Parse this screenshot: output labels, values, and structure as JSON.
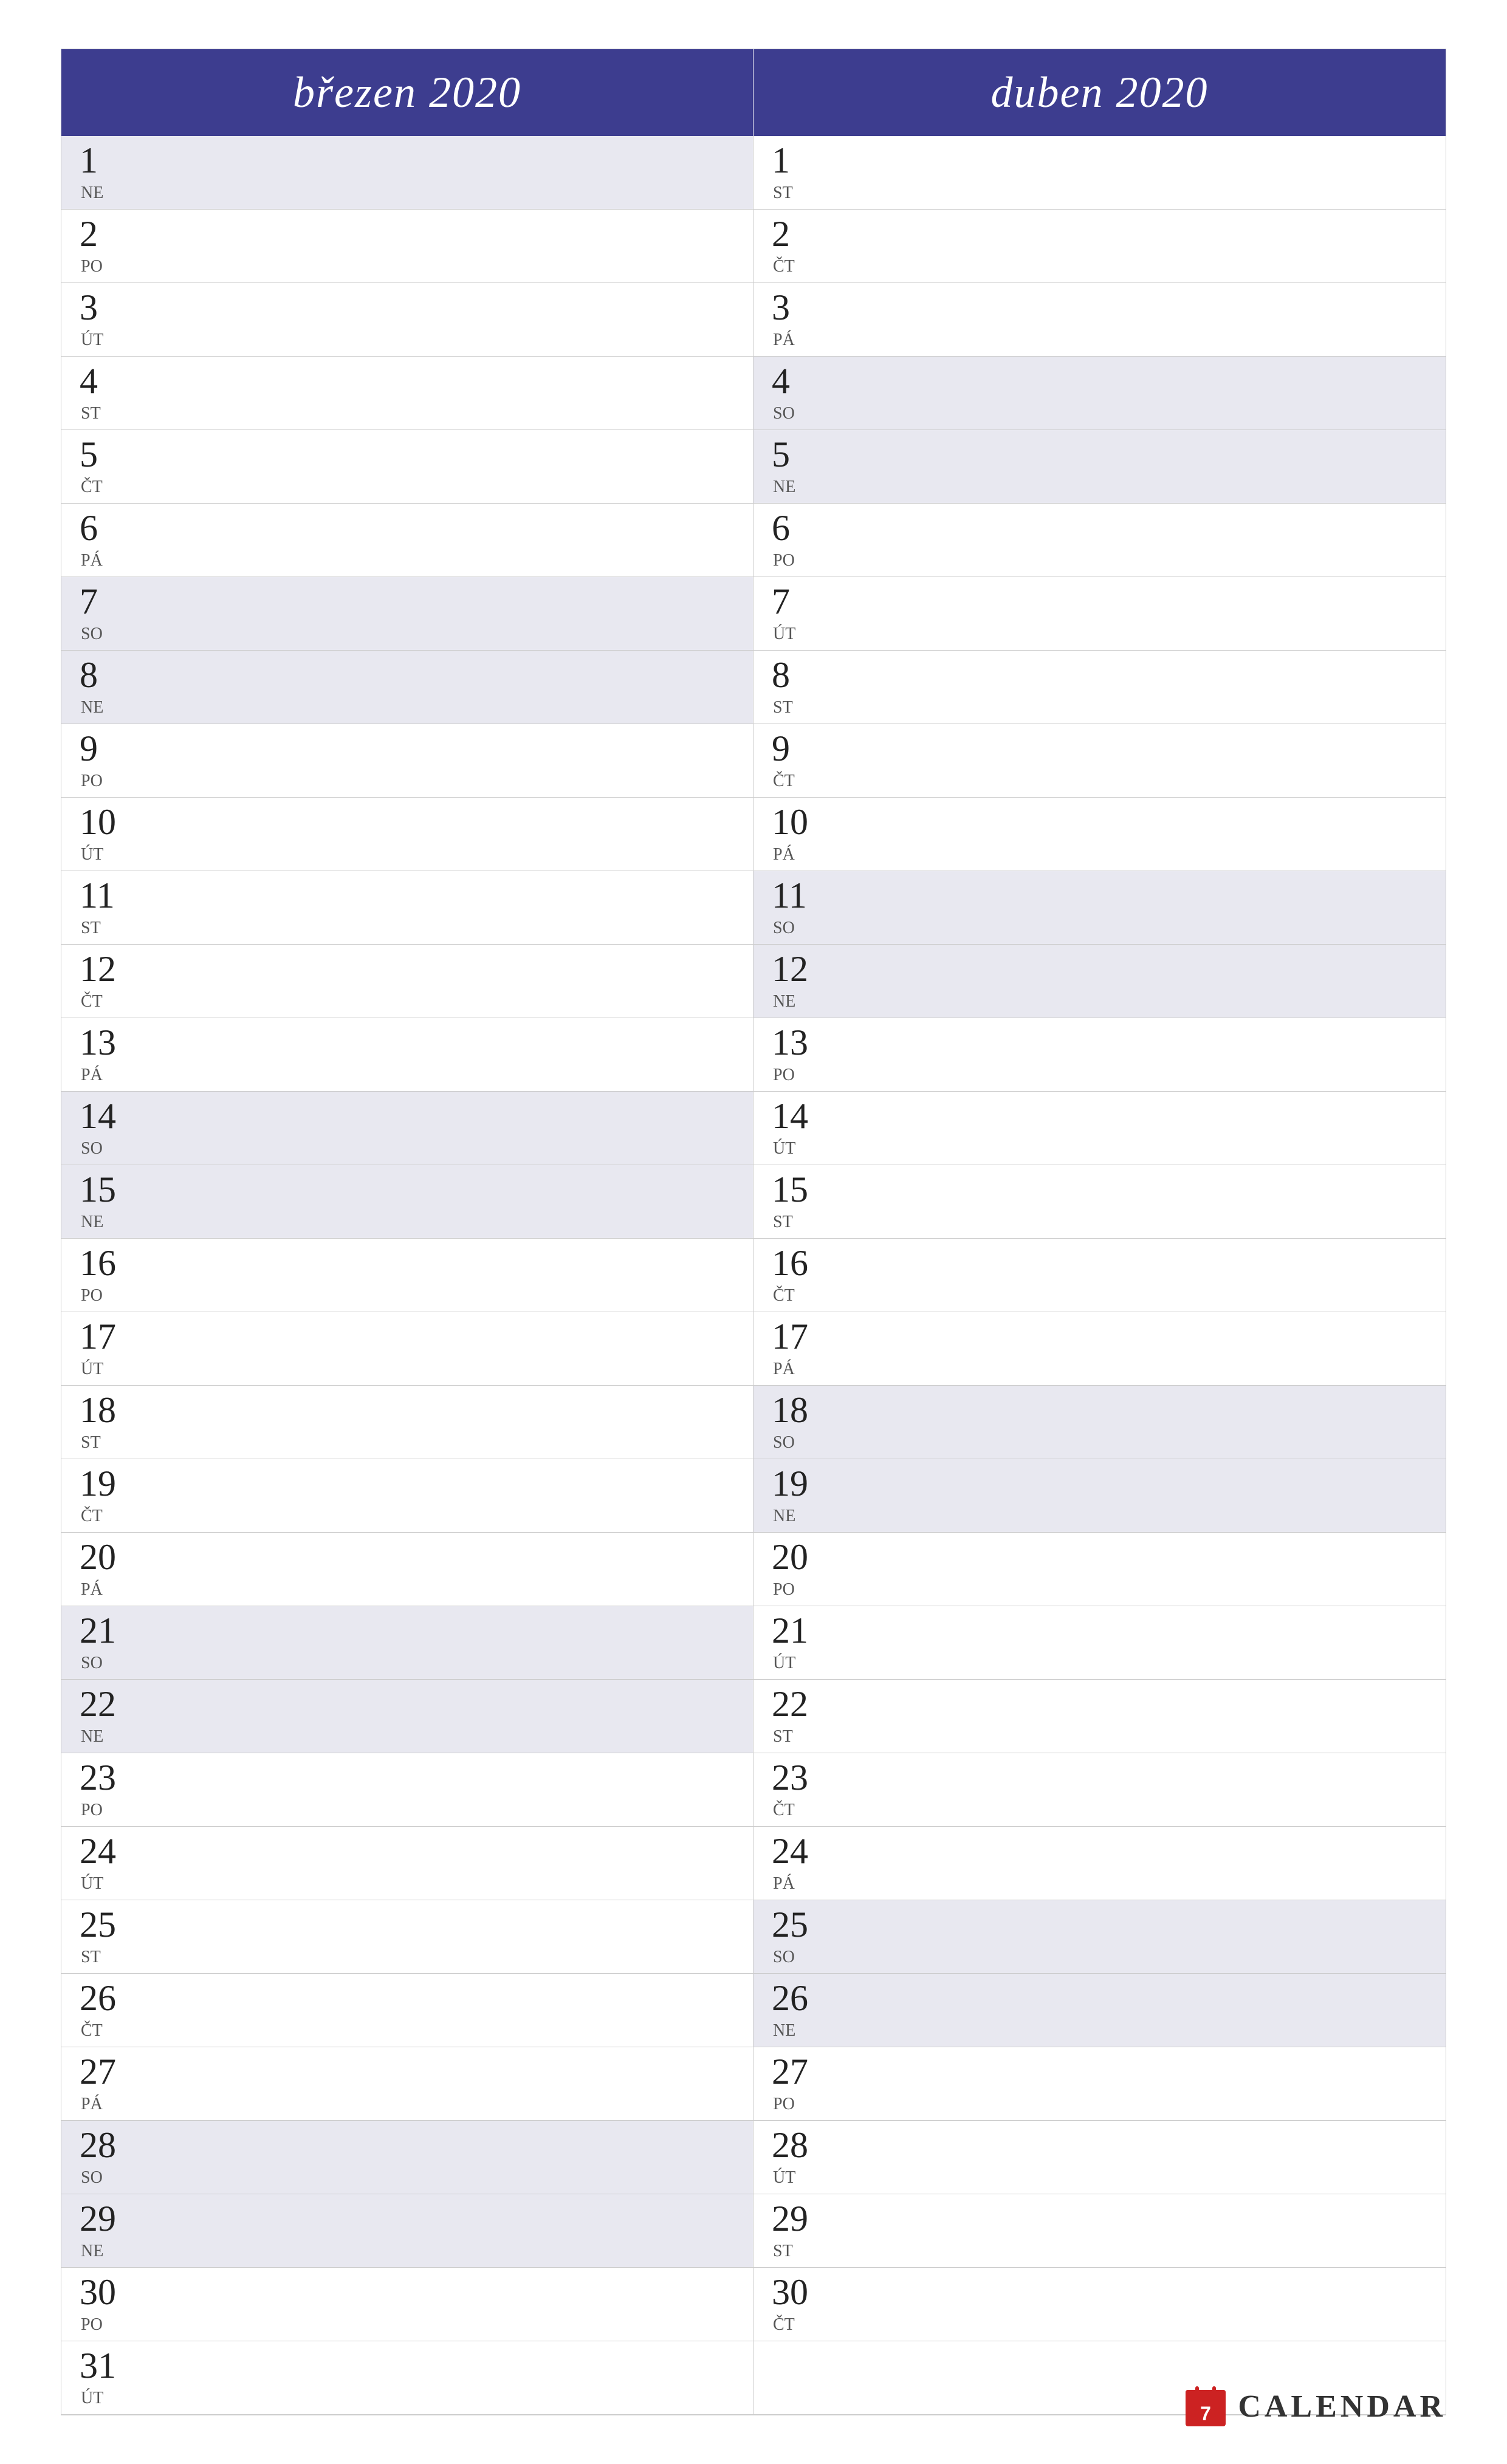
{
  "months": [
    {
      "name": "březen 2020",
      "days": [
        {
          "num": "1",
          "abbr": "NE",
          "weekend": true
        },
        {
          "num": "2",
          "abbr": "PO",
          "weekend": false
        },
        {
          "num": "3",
          "abbr": "ÚT",
          "weekend": false
        },
        {
          "num": "4",
          "abbr": "ST",
          "weekend": false
        },
        {
          "num": "5",
          "abbr": "ČT",
          "weekend": false
        },
        {
          "num": "6",
          "abbr": "PÁ",
          "weekend": false
        },
        {
          "num": "7",
          "abbr": "SO",
          "weekend": true
        },
        {
          "num": "8",
          "abbr": "NE",
          "weekend": true
        },
        {
          "num": "9",
          "abbr": "PO",
          "weekend": false
        },
        {
          "num": "10",
          "abbr": "ÚT",
          "weekend": false
        },
        {
          "num": "11",
          "abbr": "ST",
          "weekend": false
        },
        {
          "num": "12",
          "abbr": "ČT",
          "weekend": false
        },
        {
          "num": "13",
          "abbr": "PÁ",
          "weekend": false
        },
        {
          "num": "14",
          "abbr": "SO",
          "weekend": true
        },
        {
          "num": "15",
          "abbr": "NE",
          "weekend": true
        },
        {
          "num": "16",
          "abbr": "PO",
          "weekend": false
        },
        {
          "num": "17",
          "abbr": "ÚT",
          "weekend": false
        },
        {
          "num": "18",
          "abbr": "ST",
          "weekend": false
        },
        {
          "num": "19",
          "abbr": "ČT",
          "weekend": false
        },
        {
          "num": "20",
          "abbr": "PÁ",
          "weekend": false
        },
        {
          "num": "21",
          "abbr": "SO",
          "weekend": true
        },
        {
          "num": "22",
          "abbr": "NE",
          "weekend": true
        },
        {
          "num": "23",
          "abbr": "PO",
          "weekend": false
        },
        {
          "num": "24",
          "abbr": "ÚT",
          "weekend": false
        },
        {
          "num": "25",
          "abbr": "ST",
          "weekend": false
        },
        {
          "num": "26",
          "abbr": "ČT",
          "weekend": false
        },
        {
          "num": "27",
          "abbr": "PÁ",
          "weekend": false
        },
        {
          "num": "28",
          "abbr": "SO",
          "weekend": true
        },
        {
          "num": "29",
          "abbr": "NE",
          "weekend": true
        },
        {
          "num": "30",
          "abbr": "PO",
          "weekend": false
        },
        {
          "num": "31",
          "abbr": "ÚT",
          "weekend": false
        }
      ]
    },
    {
      "name": "duben 2020",
      "days": [
        {
          "num": "1",
          "abbr": "ST",
          "weekend": false
        },
        {
          "num": "2",
          "abbr": "ČT",
          "weekend": false
        },
        {
          "num": "3",
          "abbr": "PÁ",
          "weekend": false
        },
        {
          "num": "4",
          "abbr": "SO",
          "weekend": true
        },
        {
          "num": "5",
          "abbr": "NE",
          "weekend": true
        },
        {
          "num": "6",
          "abbr": "PO",
          "weekend": false
        },
        {
          "num": "7",
          "abbr": "ÚT",
          "weekend": false
        },
        {
          "num": "8",
          "abbr": "ST",
          "weekend": false
        },
        {
          "num": "9",
          "abbr": "ČT",
          "weekend": false
        },
        {
          "num": "10",
          "abbr": "PÁ",
          "weekend": false
        },
        {
          "num": "11",
          "abbr": "SO",
          "weekend": true
        },
        {
          "num": "12",
          "abbr": "NE",
          "weekend": true
        },
        {
          "num": "13",
          "abbr": "PO",
          "weekend": false
        },
        {
          "num": "14",
          "abbr": "ÚT",
          "weekend": false
        },
        {
          "num": "15",
          "abbr": "ST",
          "weekend": false
        },
        {
          "num": "16",
          "abbr": "ČT",
          "weekend": false
        },
        {
          "num": "17",
          "abbr": "PÁ",
          "weekend": false
        },
        {
          "num": "18",
          "abbr": "SO",
          "weekend": true
        },
        {
          "num": "19",
          "abbr": "NE",
          "weekend": true
        },
        {
          "num": "20",
          "abbr": "PO",
          "weekend": false
        },
        {
          "num": "21",
          "abbr": "ÚT",
          "weekend": false
        },
        {
          "num": "22",
          "abbr": "ST",
          "weekend": false
        },
        {
          "num": "23",
          "abbr": "ČT",
          "weekend": false
        },
        {
          "num": "24",
          "abbr": "PÁ",
          "weekend": false
        },
        {
          "num": "25",
          "abbr": "SO",
          "weekend": true
        },
        {
          "num": "26",
          "abbr": "NE",
          "weekend": true
        },
        {
          "num": "27",
          "abbr": "PO",
          "weekend": false
        },
        {
          "num": "28",
          "abbr": "ÚT",
          "weekend": false
        },
        {
          "num": "29",
          "abbr": "ST",
          "weekend": false
        },
        {
          "num": "30",
          "abbr": "ČT",
          "weekend": false
        }
      ]
    }
  ],
  "footer": {
    "label": "CALENDAR"
  }
}
